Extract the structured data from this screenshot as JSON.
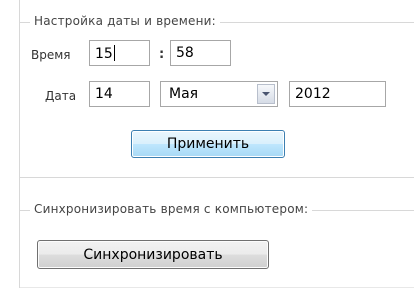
{
  "datetime_section": {
    "legend": "Настройка даты и времени:",
    "time_label": "Время",
    "hours_value": "15",
    "time_separator": ":",
    "minutes_value": "58",
    "date_label": "Дата",
    "day_value": "14",
    "month_selected": "Мая",
    "year_value": "2012",
    "apply_label": "Применить"
  },
  "sync_section": {
    "legend": "Синхронизировать время с компьютером:",
    "sync_label": "Синхронизировать"
  },
  "icons": {
    "dropdown": "chevron-down-icon"
  }
}
